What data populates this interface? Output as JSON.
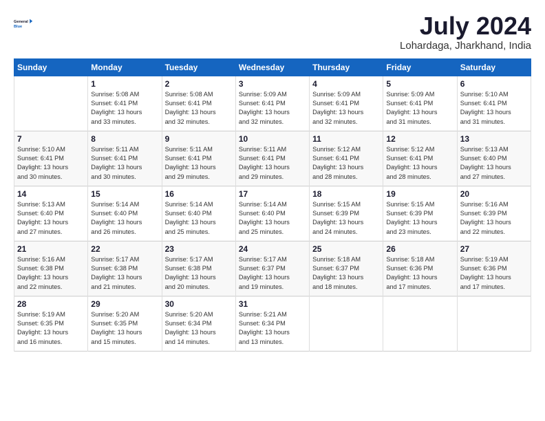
{
  "header": {
    "logo_line1": "General",
    "logo_line2": "Blue",
    "month": "July 2024",
    "location": "Lohardaga, Jharkhand, India"
  },
  "weekdays": [
    "Sunday",
    "Monday",
    "Tuesday",
    "Wednesday",
    "Thursday",
    "Friday",
    "Saturday"
  ],
  "weeks": [
    [
      {
        "day": "",
        "info": ""
      },
      {
        "day": "1",
        "info": "Sunrise: 5:08 AM\nSunset: 6:41 PM\nDaylight: 13 hours\nand 33 minutes."
      },
      {
        "day": "2",
        "info": "Sunrise: 5:08 AM\nSunset: 6:41 PM\nDaylight: 13 hours\nand 32 minutes."
      },
      {
        "day": "3",
        "info": "Sunrise: 5:09 AM\nSunset: 6:41 PM\nDaylight: 13 hours\nand 32 minutes."
      },
      {
        "day": "4",
        "info": "Sunrise: 5:09 AM\nSunset: 6:41 PM\nDaylight: 13 hours\nand 32 minutes."
      },
      {
        "day": "5",
        "info": "Sunrise: 5:09 AM\nSunset: 6:41 PM\nDaylight: 13 hours\nand 31 minutes."
      },
      {
        "day": "6",
        "info": "Sunrise: 5:10 AM\nSunset: 6:41 PM\nDaylight: 13 hours\nand 31 minutes."
      }
    ],
    [
      {
        "day": "7",
        "info": "Sunrise: 5:10 AM\nSunset: 6:41 PM\nDaylight: 13 hours\nand 30 minutes."
      },
      {
        "day": "8",
        "info": "Sunrise: 5:11 AM\nSunset: 6:41 PM\nDaylight: 13 hours\nand 30 minutes."
      },
      {
        "day": "9",
        "info": "Sunrise: 5:11 AM\nSunset: 6:41 PM\nDaylight: 13 hours\nand 29 minutes."
      },
      {
        "day": "10",
        "info": "Sunrise: 5:11 AM\nSunset: 6:41 PM\nDaylight: 13 hours\nand 29 minutes."
      },
      {
        "day": "11",
        "info": "Sunrise: 5:12 AM\nSunset: 6:41 PM\nDaylight: 13 hours\nand 28 minutes."
      },
      {
        "day": "12",
        "info": "Sunrise: 5:12 AM\nSunset: 6:41 PM\nDaylight: 13 hours\nand 28 minutes."
      },
      {
        "day": "13",
        "info": "Sunrise: 5:13 AM\nSunset: 6:40 PM\nDaylight: 13 hours\nand 27 minutes."
      }
    ],
    [
      {
        "day": "14",
        "info": "Sunrise: 5:13 AM\nSunset: 6:40 PM\nDaylight: 13 hours\nand 27 minutes."
      },
      {
        "day": "15",
        "info": "Sunrise: 5:14 AM\nSunset: 6:40 PM\nDaylight: 13 hours\nand 26 minutes."
      },
      {
        "day": "16",
        "info": "Sunrise: 5:14 AM\nSunset: 6:40 PM\nDaylight: 13 hours\nand 25 minutes."
      },
      {
        "day": "17",
        "info": "Sunrise: 5:14 AM\nSunset: 6:40 PM\nDaylight: 13 hours\nand 25 minutes."
      },
      {
        "day": "18",
        "info": "Sunrise: 5:15 AM\nSunset: 6:39 PM\nDaylight: 13 hours\nand 24 minutes."
      },
      {
        "day": "19",
        "info": "Sunrise: 5:15 AM\nSunset: 6:39 PM\nDaylight: 13 hours\nand 23 minutes."
      },
      {
        "day": "20",
        "info": "Sunrise: 5:16 AM\nSunset: 6:39 PM\nDaylight: 13 hours\nand 22 minutes."
      }
    ],
    [
      {
        "day": "21",
        "info": "Sunrise: 5:16 AM\nSunset: 6:38 PM\nDaylight: 13 hours\nand 22 minutes."
      },
      {
        "day": "22",
        "info": "Sunrise: 5:17 AM\nSunset: 6:38 PM\nDaylight: 13 hours\nand 21 minutes."
      },
      {
        "day": "23",
        "info": "Sunrise: 5:17 AM\nSunset: 6:38 PM\nDaylight: 13 hours\nand 20 minutes."
      },
      {
        "day": "24",
        "info": "Sunrise: 5:17 AM\nSunset: 6:37 PM\nDaylight: 13 hours\nand 19 minutes."
      },
      {
        "day": "25",
        "info": "Sunrise: 5:18 AM\nSunset: 6:37 PM\nDaylight: 13 hours\nand 18 minutes."
      },
      {
        "day": "26",
        "info": "Sunrise: 5:18 AM\nSunset: 6:36 PM\nDaylight: 13 hours\nand 17 minutes."
      },
      {
        "day": "27",
        "info": "Sunrise: 5:19 AM\nSunset: 6:36 PM\nDaylight: 13 hours\nand 17 minutes."
      }
    ],
    [
      {
        "day": "28",
        "info": "Sunrise: 5:19 AM\nSunset: 6:35 PM\nDaylight: 13 hours\nand 16 minutes."
      },
      {
        "day": "29",
        "info": "Sunrise: 5:20 AM\nSunset: 6:35 PM\nDaylight: 13 hours\nand 15 minutes."
      },
      {
        "day": "30",
        "info": "Sunrise: 5:20 AM\nSunset: 6:34 PM\nDaylight: 13 hours\nand 14 minutes."
      },
      {
        "day": "31",
        "info": "Sunrise: 5:21 AM\nSunset: 6:34 PM\nDaylight: 13 hours\nand 13 minutes."
      },
      {
        "day": "",
        "info": ""
      },
      {
        "day": "",
        "info": ""
      },
      {
        "day": "",
        "info": ""
      }
    ]
  ]
}
